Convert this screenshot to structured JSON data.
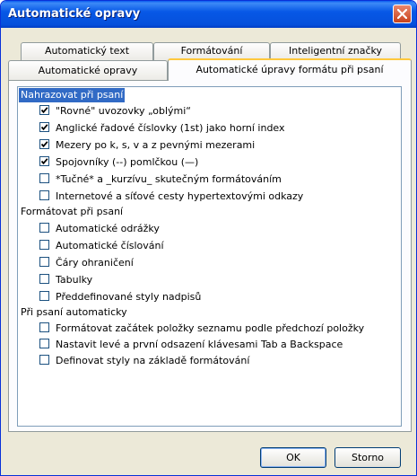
{
  "window": {
    "title": "Automatické opravy"
  },
  "tabs_back": [
    {
      "label": "Automatický text"
    },
    {
      "label": "Formátování"
    },
    {
      "label": "Inteligentní značky"
    }
  ],
  "tabs_front": [
    {
      "label": "Automatické opravy"
    },
    {
      "label": "Automatické úpravy formátu při psaní"
    }
  ],
  "groups": [
    {
      "label": "Nahrazovat při psaní",
      "selected": true,
      "items": [
        {
          "label": "\"Rovné\" uvozovky „oblými“",
          "checked": true
        },
        {
          "label": "Anglické řadové číslovky (1st) jako horní index",
          "checked": true
        },
        {
          "label": "Mezery po k, s, v a z pevnými mezerami",
          "checked": true
        },
        {
          "label": "Spojovníky (--) pomlčkou (—)",
          "checked": true
        },
        {
          "label": "*Tučné* a _kurzívu_ skutečným formátováním",
          "checked": false
        },
        {
          "label": "Internetové a síťové cesty hypertextovými odkazy",
          "checked": false
        }
      ]
    },
    {
      "label": "Formátovat při psaní",
      "selected": false,
      "items": [
        {
          "label": "Automatické odrážky",
          "checked": false
        },
        {
          "label": "Automatické číslování",
          "checked": false
        },
        {
          "label": "Čáry ohraničení",
          "checked": false
        },
        {
          "label": "Tabulky",
          "checked": false
        },
        {
          "label": "Předdefinované styly nadpisů",
          "checked": false
        }
      ]
    },
    {
      "label": "Při psaní automaticky",
      "selected": false,
      "items": [
        {
          "label": "Formátovat začátek položky seznamu podle předchozí položky",
          "checked": false
        },
        {
          "label": "Nastavit levé a první odsazení klávesami Tab a Backspace",
          "checked": false
        },
        {
          "label": "Definovat styly na základě formátování",
          "checked": false
        }
      ]
    }
  ],
  "buttons": {
    "ok": "OK",
    "cancel": "Storno"
  }
}
